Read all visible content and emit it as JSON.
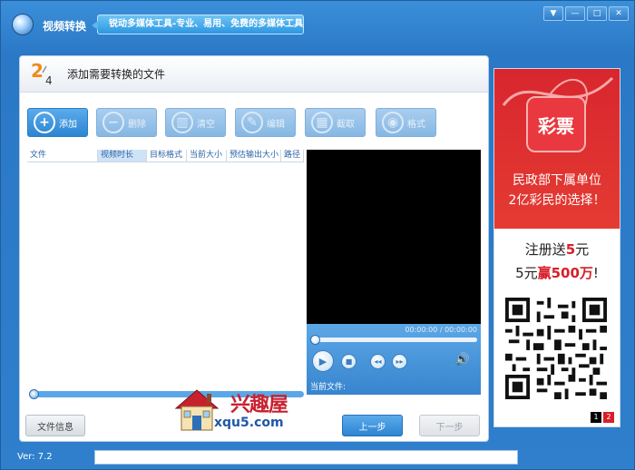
{
  "window": {
    "title": "视频转换",
    "slogan": "锐动多媒体工具-专业、易用、免费的多媒体工具",
    "controls": [
      "▼",
      "—",
      "□",
      "✕"
    ]
  },
  "step": {
    "current": "2",
    "total": "4",
    "title": "添加需要转换的文件"
  },
  "toolbar": {
    "add": "添加",
    "delete": "删除",
    "clear": "清空",
    "edit": "编辑",
    "clip": "截取",
    "format": "格式"
  },
  "file_list": {
    "columns": [
      "文件",
      "视频时长",
      "目标格式",
      "当前大小",
      "预估输出大小",
      "路径"
    ]
  },
  "player": {
    "time": "00:00:00 / 00:00:00",
    "current_file_label": "当前文件:"
  },
  "buttons": {
    "file_info": "文件信息",
    "prev": "上一步",
    "next": "下一步"
  },
  "watermark": {
    "title": "兴趣屋",
    "url": "xqu5.com"
  },
  "ad": {
    "logo": "彩票",
    "line1": "民政部下属单位",
    "line2": "2亿彩民的选择！",
    "line3a": "注册送",
    "line3b": "5",
    "line3c": "元",
    "line4a": "5元",
    "line4b": "赢500万",
    "line4c": "!",
    "pages": [
      "1",
      "2"
    ]
  },
  "status": {
    "version": "Ver: 7.2"
  },
  "colors": {
    "accent": "#2c85d2",
    "highlight": "#f08a1c",
    "ad_red": "#d81e28"
  }
}
